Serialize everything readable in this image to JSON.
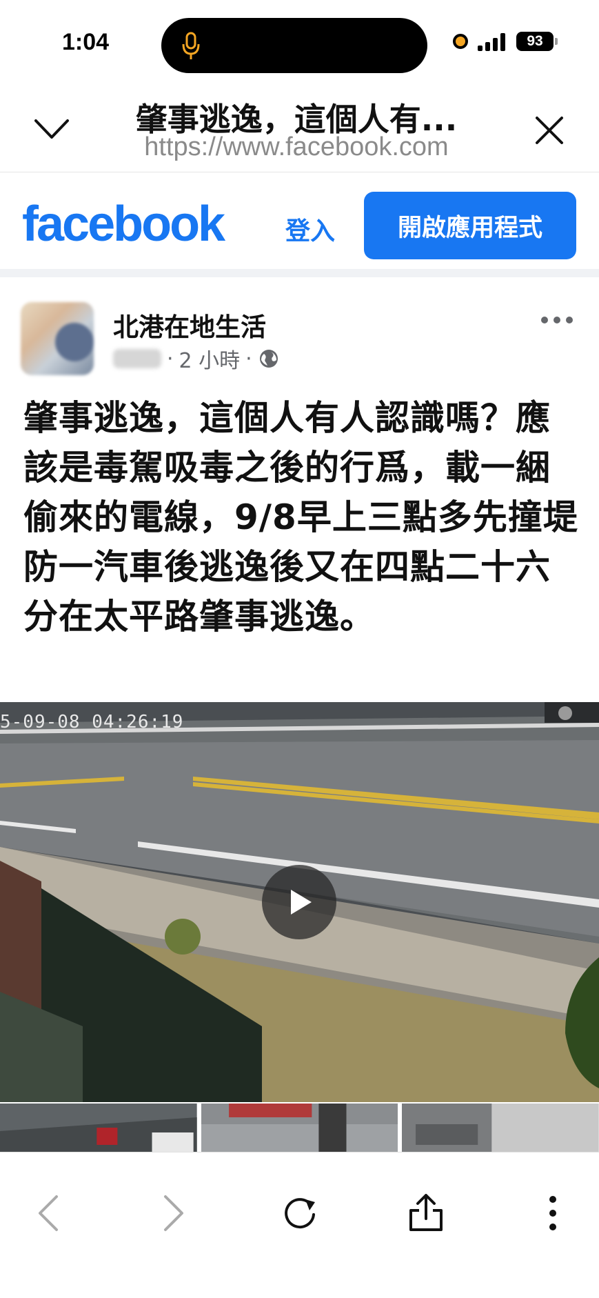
{
  "status_bar": {
    "time": "1:04",
    "battery": "93",
    "mic_color": "#f5a623"
  },
  "browser": {
    "title": "肇事逃逸，這個人有...",
    "url": "https://www.facebook.com"
  },
  "facebook_header": {
    "logo": "facebook",
    "login_label": "登入",
    "open_app_label": "開啟應用程式",
    "brand_color": "#1877f2"
  },
  "post": {
    "page_name": "北港在地生活",
    "time_ago": "2 小時",
    "separator": "·",
    "text": "肇事逃逸，這個人有人認識嗎？應該是毒駕吸毒之後的行爲，載一綑偷來的電線，9/8早上三點多先撞堤防一汽車後逃逸後又在四點二十六分在太平路肇事逃逸。",
    "video_timestamp": "5-09-08 04:26:19"
  },
  "icons": {
    "title_left": "chevron-down-icon",
    "title_right": "close-icon",
    "audience": "globe-icon",
    "more": "more-icon",
    "video": "play-icon",
    "nav": [
      "back-icon",
      "forward-icon",
      "reload-icon",
      "share-icon",
      "menu-icon"
    ]
  }
}
